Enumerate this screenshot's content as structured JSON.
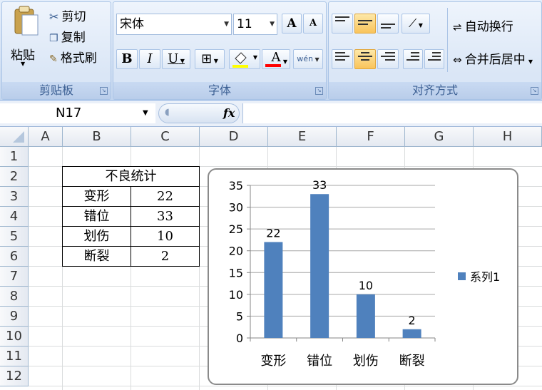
{
  "ribbon": {
    "clipboard": {
      "paste": "粘贴",
      "cut": "剪切",
      "copy": "复制",
      "format_painter": "格式刷",
      "group_label": "剪贴板"
    },
    "font": {
      "family": "宋体",
      "size": "11",
      "bold": "B",
      "italic": "I",
      "underline": "U",
      "font_color_glyph": "A",
      "phonetic_glyph": "wén",
      "group_label": "字体"
    },
    "alignment": {
      "wrap_text": "自动换行",
      "merge_center": "合并后居中",
      "group_label": "对齐方式"
    }
  },
  "formula_bar": {
    "name_box": "N17",
    "fx": "fx",
    "content": ""
  },
  "grid": {
    "columns": [
      "A",
      "B",
      "C",
      "D",
      "E",
      "F",
      "G",
      "H"
    ],
    "rows": [
      "1",
      "2",
      "3",
      "4",
      "5",
      "6",
      "7",
      "8",
      "9",
      "10",
      "11",
      "12"
    ],
    "cells": {
      "B2": "不良统计",
      "B3": "变形",
      "C3": "22",
      "B4": "错位",
      "C4": "33",
      "B5": "划伤",
      "C5": "10",
      "B6": "断裂",
      "C6": "2"
    }
  },
  "chart_data": {
    "type": "bar",
    "categories": [
      "变形",
      "错位",
      "划伤",
      "断裂"
    ],
    "series": [
      {
        "name": "系列1",
        "values": [
          22,
          33,
          10,
          2
        ]
      }
    ],
    "ylim": [
      0,
      35
    ],
    "yticks": [
      0,
      5,
      10,
      15,
      20,
      25,
      30,
      35
    ],
    "grid": true,
    "legend": "right",
    "data_labels": true,
    "color": "#4f81bd"
  }
}
